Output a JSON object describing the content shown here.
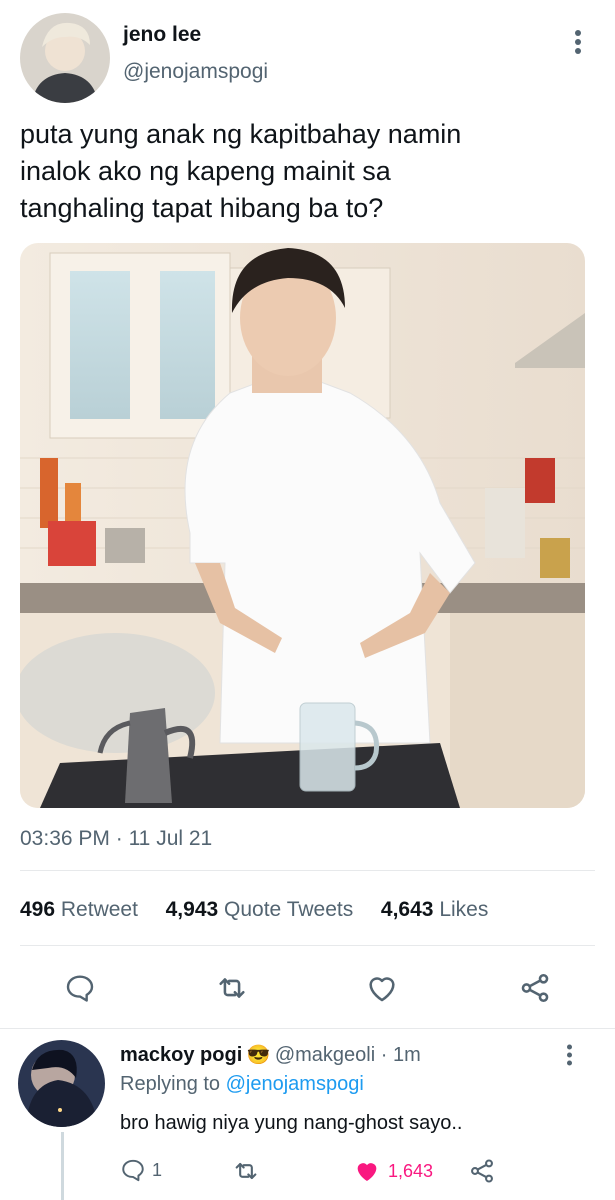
{
  "tweet": {
    "author_name": "jeno lee",
    "author_handle": "@jenojamspogi",
    "text_lines": [
      "puta yung anak ng kapitbahay namin",
      "inalok ako ng kapeng mainit sa",
      "tanghaling tapat hibang ba to?"
    ],
    "time": "03:36 PM",
    "date": "11 Jul 21",
    "retweets": "496",
    "retweets_label": "Retweet",
    "quote_tweets": "4,943",
    "quote_tweets_label": "Quote Tweets",
    "likes": "4,643",
    "likes_label": "Likes"
  },
  "reply": {
    "author_name": "mackoy pogi",
    "emoji": "😎",
    "author_handle": "@makgeoli",
    "age": "1m",
    "replying_to_label": "Replying to",
    "replying_to_handle": "@jenojamspogi",
    "text": "bro hawig niya yung nang-ghost sayo..",
    "reply_count": "1",
    "like_count": "1,643"
  },
  "colors": {
    "accent": "#1d9bf0",
    "like": "#f91880",
    "secondary_text": "#536471"
  },
  "icons": [
    "more-icon",
    "reply-icon",
    "retweet-icon",
    "like-icon",
    "share-icon"
  ]
}
